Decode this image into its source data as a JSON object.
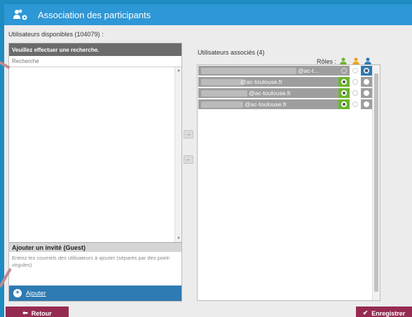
{
  "window": {
    "title": "Association des participants"
  },
  "available": {
    "label": "Utilisateurs disponibles (104079) :",
    "header": "Veuillez effectuer une recherche.",
    "search_placeholder": "Recherche"
  },
  "guest": {
    "header": "Ajouter un invité (Guest)",
    "placeholder": "Entrez les courriels des utilisateurs à ajouter (séparés par des point-virgules)",
    "add_label": "Ajouter"
  },
  "transfer": {
    "right_arrow": "→",
    "left_arrow": "←"
  },
  "associated": {
    "label": "Utilisateurs associés (4)",
    "roles_label": "Rôles :",
    "role_colors": [
      "#6cb52d",
      "#e8a317",
      "#2e7ab3"
    ],
    "rows": [
      {
        "email_suffix": "@ac-t...",
        "role": 2
      },
      {
        "email_suffix": "@ac-toulouse.fr",
        "role": 0
      },
      {
        "email_suffix": "@ac-toulouse.fr",
        "role": 0
      },
      {
        "email_suffix": "@ac-toulouse.fr",
        "role": 0
      }
    ]
  },
  "footer": {
    "back_label": "Retour",
    "save_label": "Enregistrer"
  },
  "colors": {
    "titlebar": "#2e97d6",
    "accent_button": "#962b52",
    "add_bar": "#2e7ab3"
  }
}
